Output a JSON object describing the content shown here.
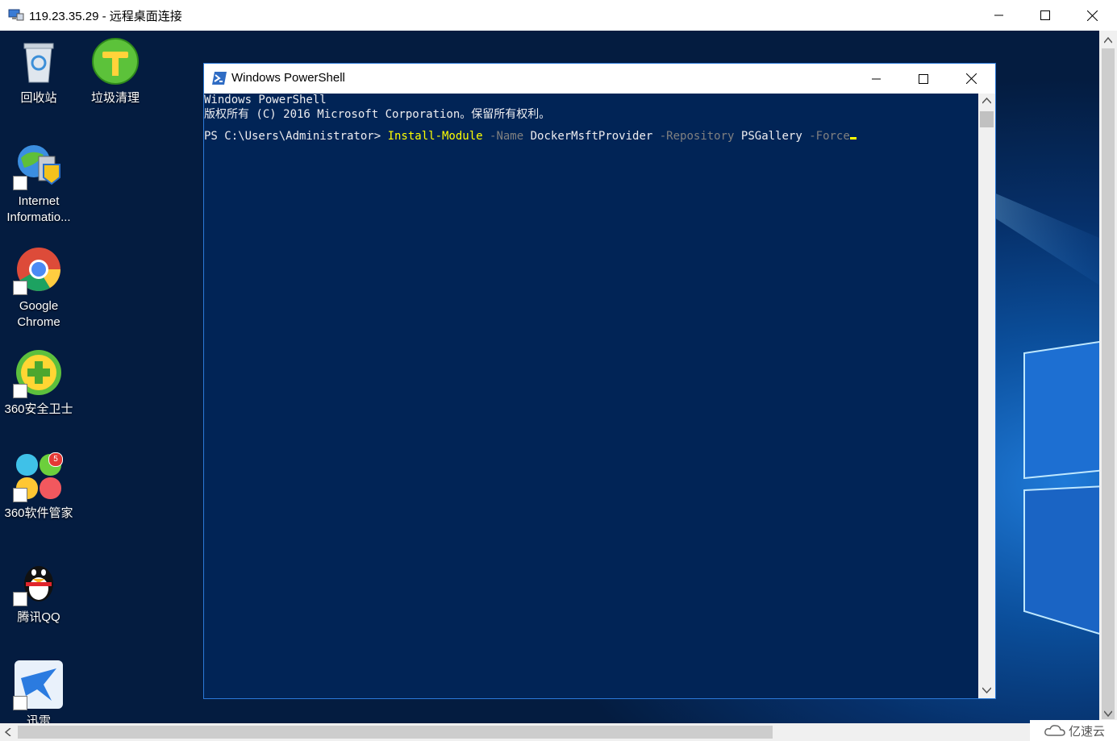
{
  "rdp": {
    "title": "119.23.35.29 - 远程桌面连接",
    "icons": {
      "app": "remote-desktop-icon",
      "minimize": "minimize-icon",
      "maximize": "maximize-icon",
      "close": "close-icon"
    }
  },
  "desktop": {
    "icons": [
      {
        "label": "回收站",
        "icon": "recycle-bin-icon"
      },
      {
        "label": "垃圾清理",
        "icon": "trash-cleaner-icon"
      },
      {
        "label": "Internet Informatio...",
        "icon": "iis-icon"
      },
      {
        "label": "Google Chrome",
        "icon": "chrome-icon"
      },
      {
        "label": "360安全卫士",
        "icon": "360-security-icon"
      },
      {
        "label": "360软件管家",
        "icon": "360-software-manager-icon",
        "badge": "5"
      },
      {
        "label": "腾讯QQ",
        "icon": "qq-penguin-icon"
      },
      {
        "label": "迅雷",
        "icon": "xunlei-bird-icon"
      }
    ]
  },
  "powershell": {
    "title": "Windows PowerShell",
    "lines": {
      "banner1": "Windows PowerShell",
      "banner2": "版权所有 (C) 2016 Microsoft Corporation。保留所有权利。",
      "prompt": "PS C:\\Users\\Administrator> ",
      "cmd": "Install-Module",
      "p1": " -Name",
      "v1": " DockerMsftProvider",
      "p2": " -Repository",
      "v2": " PSGallery",
      "p3": " -Force"
    },
    "colors": {
      "background": "#012456",
      "text": "#eeedf0",
      "command": "#ffff00",
      "parameter": "#808080"
    }
  },
  "watermark": {
    "text": "亿速云",
    "icon": "cloud-logo-icon"
  }
}
